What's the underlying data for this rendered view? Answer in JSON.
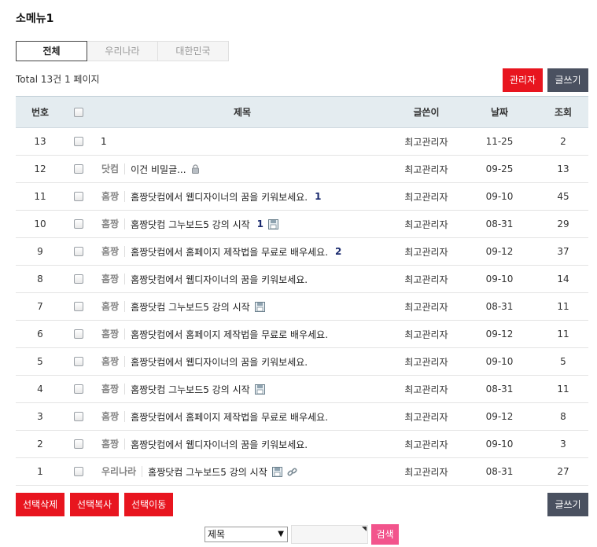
{
  "title": "소메뉴1",
  "tabs": [
    "전체",
    "우리나라",
    "대한민국"
  ],
  "total_text": "Total 13건 1 페이지",
  "buttons": {
    "admin": "관리자",
    "write": "글쓰기",
    "delete": "선택삭제",
    "copy": "선택복사",
    "move": "선택이동",
    "write_bottom": "글쓰기"
  },
  "headers": {
    "num": "번호",
    "subject": "제목",
    "name": "글쓴이",
    "date": "날짜",
    "hit": "조회"
  },
  "rows": [
    {
      "num": "13",
      "cat": "",
      "subject": "1",
      "comments": "",
      "icons": [],
      "name": "최고관리자",
      "date": "11-25",
      "hit": "2"
    },
    {
      "num": "12",
      "cat": "닷컴",
      "subject": "이건 비밀글...",
      "comments": "",
      "icons": [
        "lock-icon"
      ],
      "name": "최고관리자",
      "date": "09-25",
      "hit": "13"
    },
    {
      "num": "11",
      "cat": "홈짱",
      "subject": "홈짱닷컴에서 웹디자이너의 꿈을 키워보세요.",
      "comments": "1",
      "icons": [],
      "name": "최고관리자",
      "date": "09-10",
      "hit": "45"
    },
    {
      "num": "10",
      "cat": "홈짱",
      "subject": "홈짱닷컴 그누보드5 강의 시작",
      "comments": "1",
      "icons": [
        "file-icon"
      ],
      "name": "최고관리자",
      "date": "08-31",
      "hit": "29"
    },
    {
      "num": "9",
      "cat": "홈짱",
      "subject": "홈짱닷컴에서 홈페이지 제작법을 무료로 배우세요.",
      "comments": "2",
      "icons": [],
      "name": "최고관리자",
      "date": "09-12",
      "hit": "37"
    },
    {
      "num": "8",
      "cat": "홈짱",
      "subject": "홈짱닷컴에서 웹디자이너의 꿈을 키워보세요.",
      "comments": "",
      "icons": [],
      "name": "최고관리자",
      "date": "09-10",
      "hit": "14"
    },
    {
      "num": "7",
      "cat": "홈짱",
      "subject": "홈짱닷컴 그누보드5 강의 시작",
      "comments": "",
      "icons": [
        "file-icon"
      ],
      "name": "최고관리자",
      "date": "08-31",
      "hit": "11"
    },
    {
      "num": "6",
      "cat": "홈짱",
      "subject": "홈짱닷컴에서 홈페이지 제작법을 무료로 배우세요.",
      "comments": "",
      "icons": [],
      "name": "최고관리자",
      "date": "09-12",
      "hit": "11"
    },
    {
      "num": "5",
      "cat": "홈짱",
      "subject": "홈짱닷컴에서 웹디자이너의 꿈을 키워보세요.",
      "comments": "",
      "icons": [],
      "name": "최고관리자",
      "date": "09-10",
      "hit": "5"
    },
    {
      "num": "4",
      "cat": "홈짱",
      "subject": "홈짱닷컴 그누보드5 강의 시작",
      "comments": "",
      "icons": [
        "file-icon"
      ],
      "name": "최고관리자",
      "date": "08-31",
      "hit": "11"
    },
    {
      "num": "3",
      "cat": "홈짱",
      "subject": "홈짱닷컴에서 홈페이지 제작법을 무료로 배우세요.",
      "comments": "",
      "icons": [],
      "name": "최고관리자",
      "date": "09-12",
      "hit": "8"
    },
    {
      "num": "2",
      "cat": "홈짱",
      "subject": "홈짱닷컴에서 웹디자이너의 꿈을 키워보세요.",
      "comments": "",
      "icons": [],
      "name": "최고관리자",
      "date": "09-10",
      "hit": "3"
    },
    {
      "num": "1",
      "cat": "우리나라",
      "subject": "홈짱닷컴 그누보드5 강의 시작",
      "comments": "",
      "icons": [
        "file-icon",
        "link-icon"
      ],
      "name": "최고관리자",
      "date": "08-31",
      "hit": "27"
    }
  ],
  "search": {
    "field": "제목",
    "button": "검색"
  },
  "colors": {
    "red": "#e8151f",
    "dark": "#4a5160",
    "header_bg": "#e4ecf0",
    "search_btn": "#f2548c"
  }
}
